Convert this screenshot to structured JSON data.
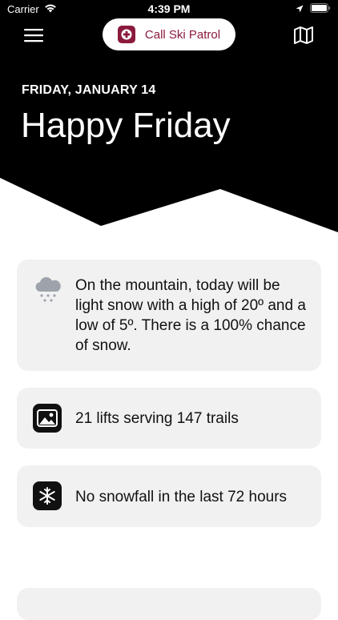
{
  "status_bar": {
    "carrier": "Carrier",
    "time": "4:39 PM"
  },
  "nav": {
    "call_patrol_label": "Call Ski Patrol",
    "menu_icon": "hamburger-menu-icon",
    "map_icon": "map-icon",
    "patrol_icon": "medical-cross-icon"
  },
  "hero": {
    "date": "FRIDAY, JANUARY 14",
    "greeting": "Happy Friday"
  },
  "cards": {
    "weather": {
      "icon": "snow-cloud-icon",
      "text": "On the mountain, today will be light snow with a high of 20º and a low of 5º. There is a 100% chance of snow."
    },
    "lifts": {
      "icon": "photo-icon",
      "text": "21 lifts serving 147 trails"
    },
    "snowfall": {
      "icon": "snowflake-icon",
      "text": "No snowfall in the last 72 hours"
    }
  },
  "colors": {
    "accent": "#8b1a3d",
    "card_background": "#f1f1f1",
    "hero_background": "#000000"
  }
}
